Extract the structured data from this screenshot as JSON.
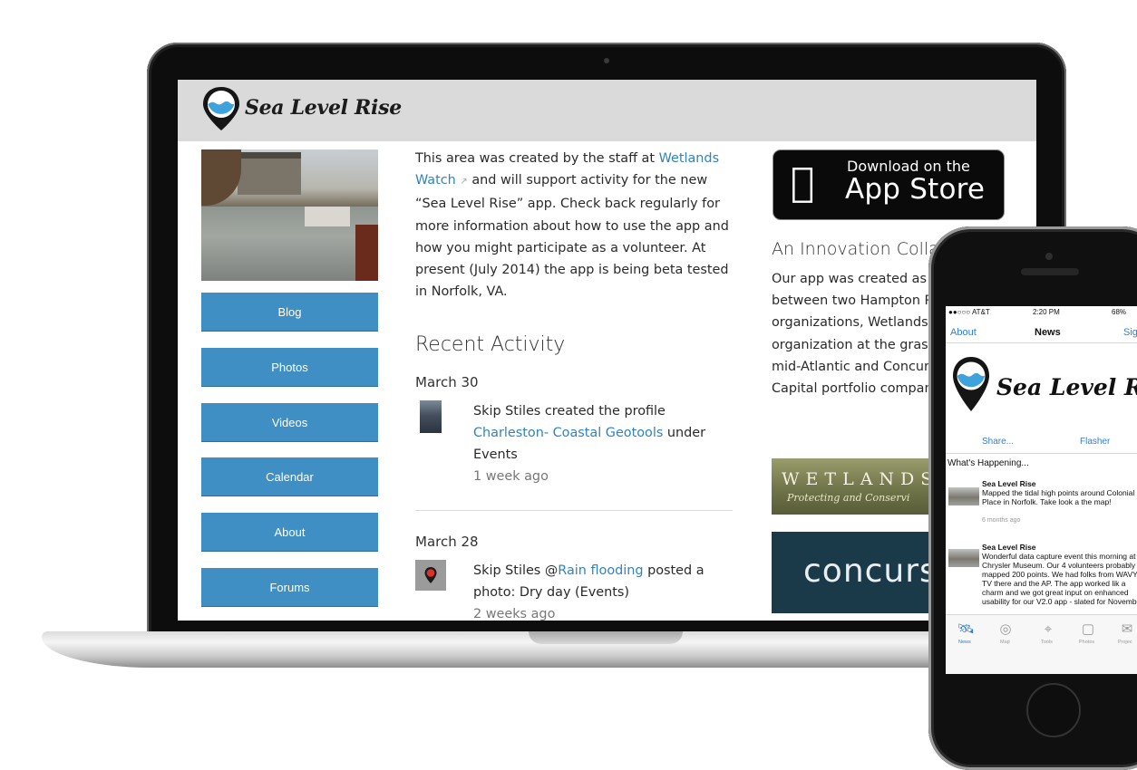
{
  "website": {
    "logo_text": "Sea Level Rise",
    "nav": [
      "Blog",
      "Photos",
      "Videos",
      "Calendar",
      "About",
      "Forums"
    ],
    "intro": {
      "part1": "This area was created by the staff at ",
      "link": "Wetlands Watch",
      "part2": " and will support activity for the new “Sea Level Rise” app. Check back regularly for more information about how to use the app and how you might participate as a volunteer. At present (July 2014) the app is being beta tested in Norfolk, VA."
    },
    "recent_title": "Recent Activity",
    "activities": [
      {
        "date": "March 30",
        "text_before": "Skip Stiles created the profile ",
        "link": "Charleston- Coastal Geotools",
        "text_after": " under Events",
        "time": "1 week ago"
      },
      {
        "date": "March 28",
        "text_before": "Skip Stiles @",
        "link": "Rain flooding",
        "text_after": " posted a photo: Dry day (Events)",
        "time": "2 weeks ago"
      }
    ],
    "appstore": {
      "small": "Download on the",
      "big": "App Store"
    },
    "innovation": {
      "title": "An Innovation Colla",
      "text": "Our app was created as a collaboration between two Hampton Roads organizations, Wetlands Watch, the only organization at the grass wetlands in the mid-Atlantic and Concursive Corporation, Capital portfolio company."
    },
    "wetlands_banner": {
      "title": "WETLANDS",
      "subtitle": "Protecting and Conservi"
    },
    "concurs_banner": "concurs"
  },
  "phone": {
    "status": {
      "carrier": "●●○○○ AT&T",
      "time": "2:20 PM",
      "battery": "68%"
    },
    "nav": {
      "left": "About",
      "title": "News",
      "right": "Sign"
    },
    "logo_text": "Sea Level Rise",
    "share": "Share...",
    "flasher": "Flasher",
    "whats_happening": "What's Happening...",
    "posts": [
      {
        "title": "Sea Level Rise",
        "text": "Mapped the tidal high points around Colonial Place in Norfolk. Take look a the map!",
        "time": "6 months ago"
      },
      {
        "title": "Sea Level Rise",
        "text": "Wonderful data capture event this morning at Chrysler Museum. Our 4 volunteers probably mapped 200 points.  We had folks from WAVY-TV there and the AP.  The app worked lik a charm and we got great input on enhanced usability for our V2.0 app - slated for November"
      }
    ],
    "tabs": [
      "News",
      "Map",
      "Tools",
      "Photos",
      "Projec"
    ]
  },
  "colors": {
    "nav_button": "#3f8fc5",
    "link": "#2f83bf",
    "phone_accent": "#2f7fd0"
  }
}
